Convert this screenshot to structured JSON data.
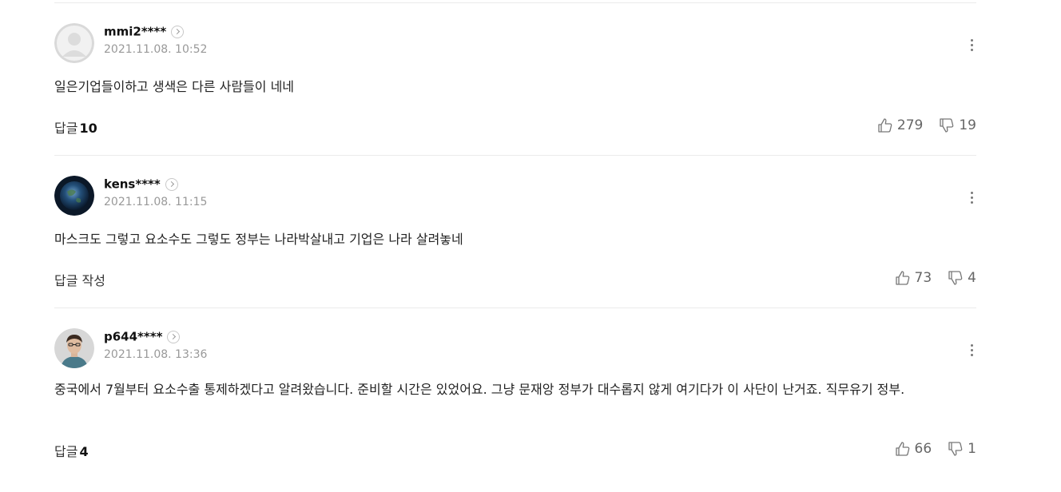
{
  "comments": [
    {
      "username": "mmi2****",
      "date": "2021.11.08. 10:52",
      "text": "일은기업들이하고 생색은 다른 사람들이 네네",
      "reply_label": "답글",
      "reply_count": "10",
      "likes": "279",
      "dislikes": "19",
      "avatar": "default-avatar-icon"
    },
    {
      "username": "kens****",
      "date": "2021.11.08. 11:15",
      "text": "마스크도 그렇고 요소수도 그렇도 정부는 나라박살내고 기업은 나라 살려놓네",
      "reply_label": "답글 작성",
      "reply_count": "",
      "likes": "73",
      "dislikes": "4",
      "avatar": "earth-avatar-icon"
    },
    {
      "username": "p644****",
      "date": "2021.11.08. 13:36",
      "text": "중국에서 7월부터 요소수출 통제하겠다고 알려왔습니다. 준비할 시간은 있었어요. 그냥 문재앙 정부가 대수롭지 않게 여기다가 이 사단이 난거죠. 직무유기 정부.",
      "reply_label": "답글",
      "reply_count": "4",
      "likes": "66",
      "dislikes": "1",
      "avatar": "person-avatar-icon"
    }
  ],
  "colors": {
    "divider": "#ebebeb",
    "meta": "#999999",
    "text": "#222222"
  }
}
